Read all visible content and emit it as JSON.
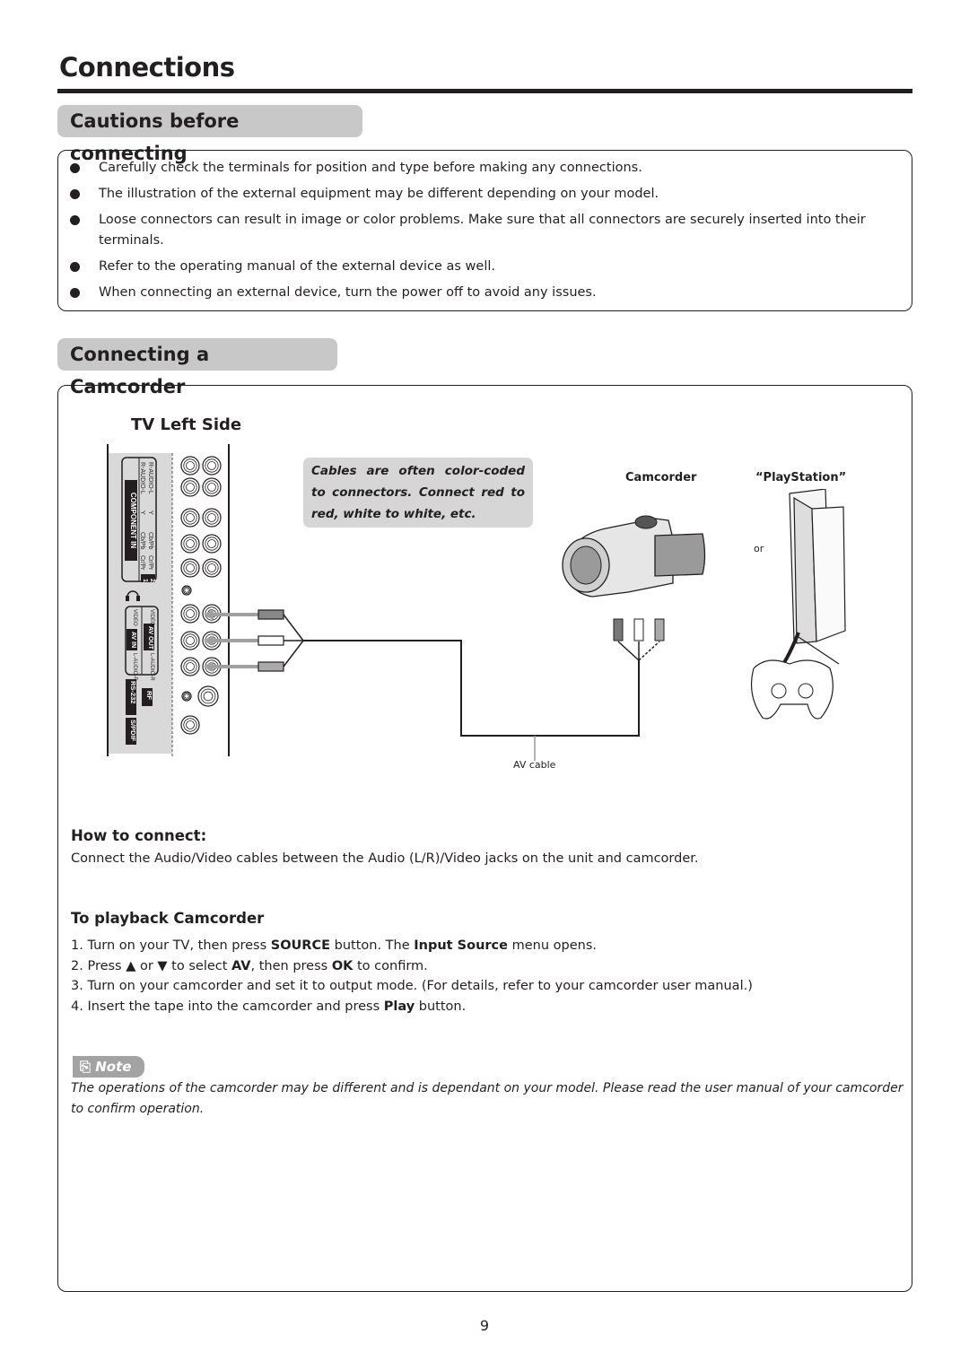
{
  "page": {
    "title": "Connections",
    "page_number": "9"
  },
  "cautions": {
    "heading": "Cautions before connecting",
    "items": [
      "Carefully check the terminals for position and type before making any connections.",
      "The illustration of the external equipment may be different depending on your model.",
      "Loose connectors can result in image or color problems. Make sure that all connectors are securely inserted into their terminals.",
      "Refer to the operating manual of the external device as well.",
      "When connecting an external device, turn the power off to avoid any issues."
    ]
  },
  "camcorder_section": {
    "heading": "Connecting a Camcorder",
    "diagram": {
      "tv_side_title": "TV Left Side",
      "panel_labels": {
        "component_in": "COMPONENT IN",
        "r_audio_l": "R-AUDIO-L",
        "y": "Y",
        "cb_pb": "Cb/Pb",
        "cr_pr": "Cr/Pr",
        "num_1": "1",
        "num_2": "2",
        "video": "VIDEO",
        "av_in": "AV IN",
        "av_out": "AV OUT",
        "l_audio_r": "L-AUDIO-R",
        "rs232": "RS-232",
        "rf": "RF",
        "spdif": "S/PDIF"
      },
      "callout": "Cables are often color-coded to connectors. Connect red to red, white to white, etc.",
      "camcorder_label": "Camcorder",
      "playstation_label": "“PlayStation”",
      "or_label": "or",
      "cable_label": "AV cable"
    },
    "how_to_connect": {
      "heading": "How to connect:",
      "text": "Connect the Audio/Video cables between the Audio (L/R)/Video jacks on the unit and camcorder."
    },
    "playback": {
      "heading": "To playback Camcorder",
      "steps": [
        {
          "num": "1.",
          "parts": [
            [
              "Turn on your TV,  then press ",
              false
            ],
            [
              "SOURCE",
              true
            ],
            [
              " button. The ",
              false
            ],
            [
              "Input Source",
              true
            ],
            [
              " menu opens.",
              false
            ]
          ]
        },
        {
          "num": "2.",
          "parts": [
            [
              "Press ▲ or ▼ to select ",
              false
            ],
            [
              "AV",
              true
            ],
            [
              ", then press ",
              false
            ],
            [
              "OK",
              true
            ],
            [
              " to confirm.",
              false
            ]
          ]
        },
        {
          "num": "3.",
          "parts": [
            [
              "Turn on your camcorder and set it to output mode. (For details, refer to your camcorder user manual.)",
              false
            ]
          ]
        },
        {
          "num": "4.",
          "parts": [
            [
              "Insert the tape into the camcorder and press ",
              false
            ],
            [
              "Play",
              true
            ],
            [
              " button.",
              false
            ]
          ]
        }
      ]
    },
    "note": {
      "label": "Note",
      "text": "The operations of the camcorder may be different and is dependant on your model. Please read the user manual of your camcorder to confirm operation."
    }
  }
}
